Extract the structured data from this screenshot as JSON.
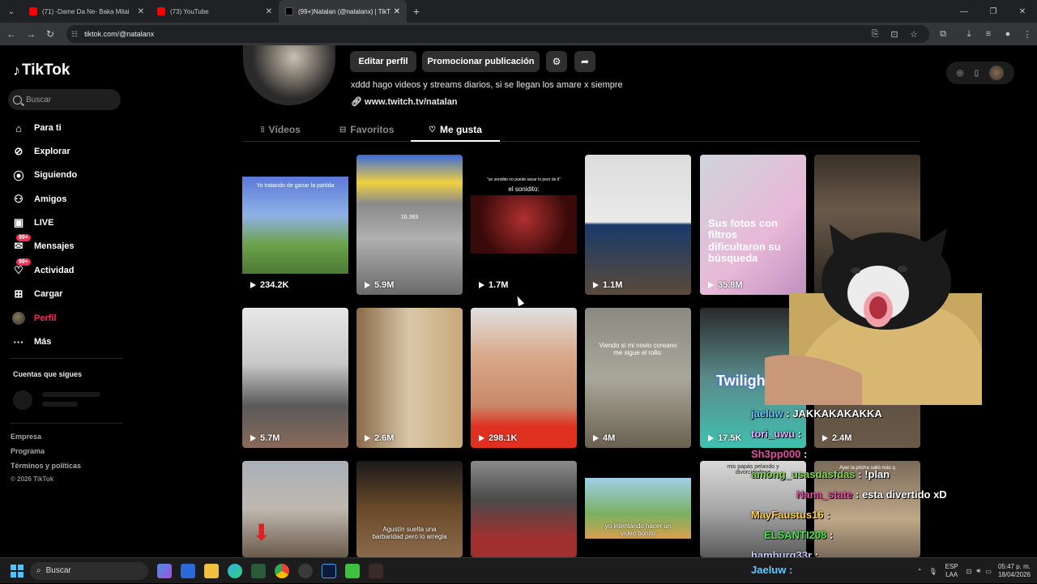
{
  "browser": {
    "tabs": [
      {
        "title": "(71) -Dame Da Ne- Baka Mitai",
        "color": "#ff0000",
        "active": false
      },
      {
        "title": "(73) YouTube",
        "color": "#ff0000",
        "active": false
      },
      {
        "title": "(99+)Natalan (@natalanx) | TikT",
        "color": "#111111",
        "active": true
      }
    ],
    "url": "tiktok.com/@natalanx"
  },
  "sidebar": {
    "logo": "TikTok",
    "search_placeholder": "Buscar",
    "items": [
      {
        "label": "Para ti",
        "icon": "home-icon"
      },
      {
        "label": "Explorar",
        "icon": "compass-icon"
      },
      {
        "label": "Siguiendo",
        "icon": "following-icon"
      },
      {
        "label": "Amigos",
        "icon": "friends-icon"
      },
      {
        "label": "LIVE",
        "icon": "live-icon"
      },
      {
        "label": "Mensajes",
        "icon": "messages-icon",
        "badge": "99+"
      },
      {
        "label": "Actividad",
        "icon": "activity-icon",
        "badge": "99+"
      },
      {
        "label": "Cargar",
        "icon": "upload-icon"
      },
      {
        "label": "Perfil",
        "icon": "avatar"
      },
      {
        "label": "Más",
        "icon": "more-icon"
      }
    ],
    "following_title": "Cuentas que sigues",
    "footer": [
      "Empresa",
      "Programa",
      "Términos y políticas"
    ],
    "copyright": "© 2026 TikTok"
  },
  "profile": {
    "edit_label": "Editar perfil",
    "promote_label": "Promocionar publicación",
    "bio": "xddd hago videos y streams diarios, si se llegan los amare x siempre",
    "link": "www.twitch.tv/natalan",
    "tabs": [
      "Vídeos",
      "Favoritos",
      "Me gusta"
    ],
    "active_tab": "Me gusta"
  },
  "videos": [
    {
      "views": "234.2K",
      "caption": "Yo tratando de ganar la partida"
    },
    {
      "views": "5.9M",
      "caption": "16.393"
    },
    {
      "views": "1.7M",
      "caption": "el sonidito:",
      "top": "\"un sonidito no puede sacar lo peor de ti\""
    },
    {
      "views": "1.1M",
      "caption": ""
    },
    {
      "views": "35.8M",
      "caption": "Sus fotos con filtros dificultaron su búsqueda"
    },
    {
      "views": "",
      "caption": ""
    },
    {
      "views": "5.7M",
      "caption": ""
    },
    {
      "views": "2.6M",
      "caption": ""
    },
    {
      "views": "298.1K",
      "caption": ""
    },
    {
      "views": "4M",
      "caption": "Viendo si mi novio coreano me sigue el rollo:"
    },
    {
      "views": "17.5K",
      "caption": "Twilight"
    },
    {
      "views": "2.4M",
      "caption": ""
    },
    {
      "views": "",
      "caption": ""
    },
    {
      "views": "",
      "caption": "Agustín suelta una barbaridad pero lo arregla"
    },
    {
      "views": "",
      "caption": ""
    },
    {
      "views": "",
      "caption": "yo intentando hacer un video bonito"
    },
    {
      "views": "",
      "caption": "mis papás pelando y divorciándose"
    },
    {
      "views": "",
      "caption": "Ayer la pricha salió más q"
    }
  ],
  "chat": [
    {
      "user": "jaeluw",
      "msg": ": JAKKAKAKAKKA"
    },
    {
      "user": "tori_uwu",
      "msg": ":"
    },
    {
      "user": "Sh3pp000",
      "msg": ":"
    },
    {
      "user": "among_usasdasfdas",
      "msg": ": !plan"
    },
    {
      "user": "Nana_state",
      "msg": ": esta divertido xD"
    },
    {
      "user": "MayFaustus16",
      "msg": ":"
    },
    {
      "user": "ELSANTI208",
      "msg": ":"
    },
    {
      "user": "hamburg33r",
      "msg": ":"
    }
  ],
  "stream_bottom": "Jaeluw :",
  "taskbar": {
    "search": "Buscar",
    "lang1": "ESP",
    "lang2": "LAA",
    "time": "05:47 p. m.",
    "date": "18/04/2026"
  }
}
